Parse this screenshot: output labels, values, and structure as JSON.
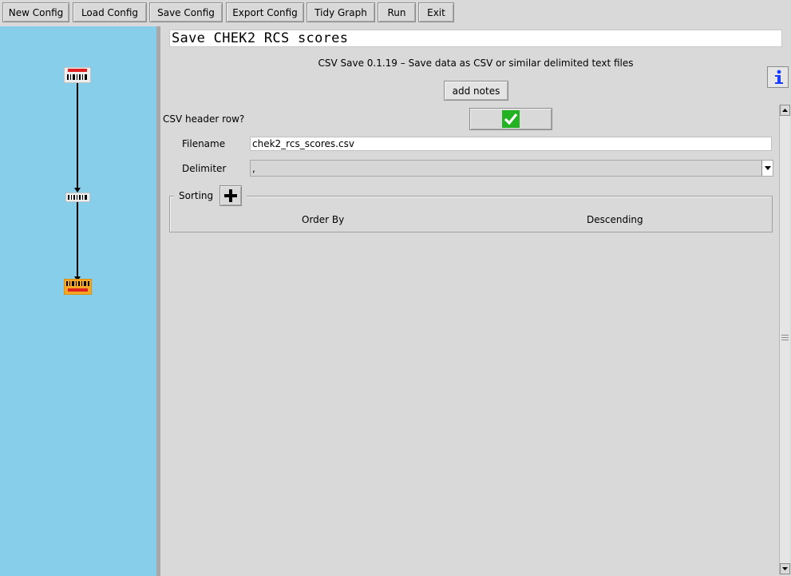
{
  "toolbar": {
    "buttons": [
      "New Config",
      "Load Config",
      "Save Config",
      "Export Config",
      "Tidy Graph",
      "Run",
      "Exit"
    ]
  },
  "node": {
    "name": "Save CHEK2 RCS scores",
    "description": "CSV Save 0.1.19 – Save data as CSV or similar delimited text files",
    "add_notes_label": "add notes"
  },
  "form": {
    "header_row_label": "CSV header row?",
    "header_row_checked": true,
    "filename_label": "Filename",
    "filename_value": "chek2_rcs_scores.csv",
    "delimiter_label": "Delimiter",
    "delimiter_value": ",",
    "sorting_label": "Sorting",
    "sorting_columns": [
      "Order By",
      "Descending"
    ]
  },
  "colors": {
    "graph_background": "#87ceeb",
    "checkbox_green": "#22b222",
    "node_red": "#e02020",
    "node_orange": "#f5a623"
  },
  "icons": {
    "info": "info-icon",
    "check": "checkmark-icon",
    "add": "plus-icon"
  }
}
